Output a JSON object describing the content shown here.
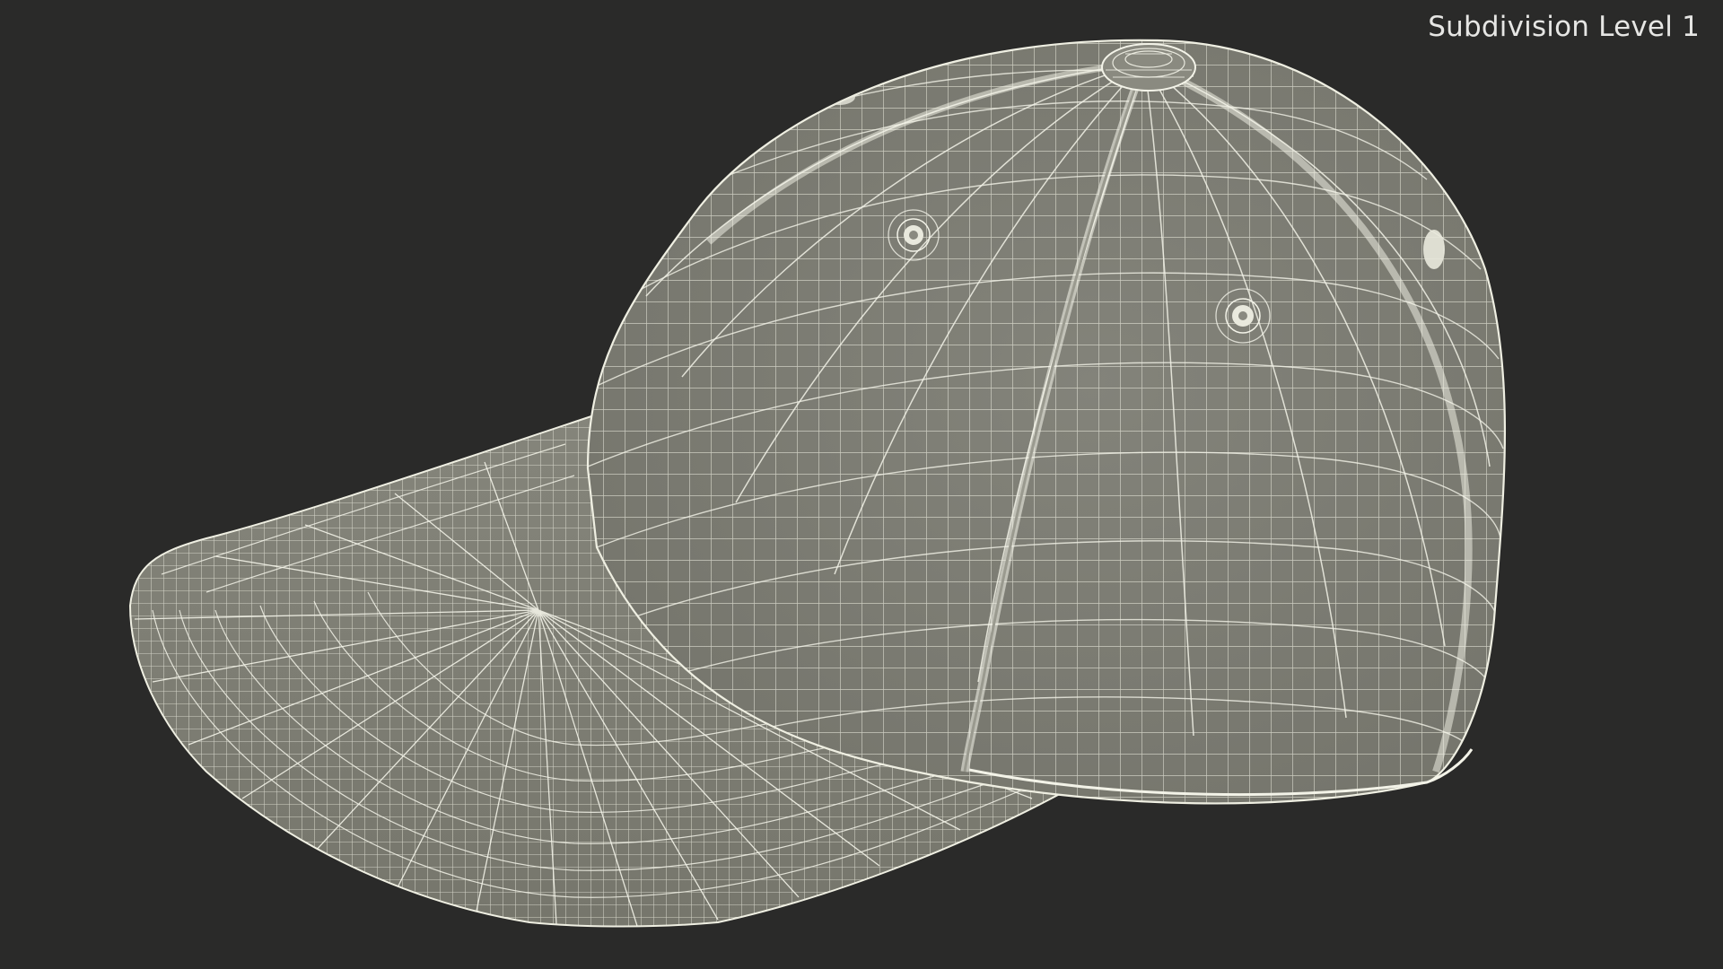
{
  "viewport": {
    "background_color": "#2a2a29",
    "overlay_label": "Subdivision Level 1"
  },
  "model": {
    "render_mode": "wireframe-over-shaded",
    "surface_color": "#7d7d70",
    "wire_color": "#f2f2e6"
  }
}
